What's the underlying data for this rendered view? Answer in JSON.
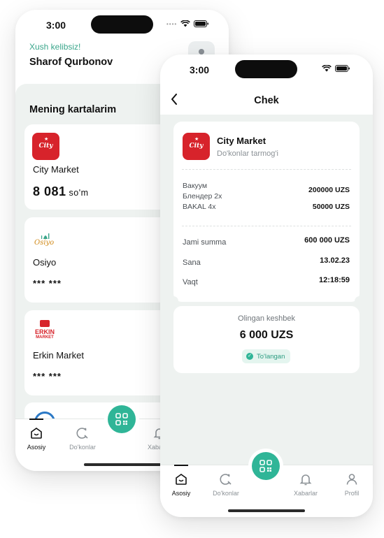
{
  "colors": {
    "accent": "#2fb597",
    "brand_red": "#d7232b",
    "background": "#eef2f0"
  },
  "back_screen": {
    "status_time": "3:00",
    "greeting": "Xush kelibsiz!",
    "user_name": "Sharof Qurbonov",
    "section_title": "Mening kartalarim",
    "cards": [
      {
        "name": "City Market",
        "logo_icon": "city-market-logo",
        "logo_text": "City",
        "balance": "8 081",
        "currency": "so'm"
      },
      {
        "name": "Osiyo",
        "logo_icon": "osiyo-logo",
        "logo_text": "Osiyo",
        "masked": "*** ***"
      },
      {
        "name": "Erkin Market",
        "logo_icon": "erkin-market-logo",
        "logo_text_1": "ERKIN",
        "logo_text_2": "MARKET",
        "masked": "*** ***"
      }
    ],
    "tabs": [
      {
        "label": "Asosiy",
        "icon": "home-icon",
        "active": true
      },
      {
        "label": "Do'konlar",
        "icon": "store-search-icon"
      },
      {
        "label": "Xabarlar",
        "icon": "bell-icon"
      }
    ]
  },
  "front_screen": {
    "status_time": "3:00",
    "title": "Chek",
    "shop_name": "City Market",
    "shop_subtitle": "Do'konlar tarmog'i",
    "logo_text": "City",
    "items": [
      {
        "name": "Вакуум",
        "price": "200000 UZS"
      },
      {
        "name": "Блендер 2x",
        "price": ""
      },
      {
        "name": "BAKAL 4x",
        "price": "50000 UZS"
      }
    ],
    "total_label": "Jami summa",
    "total_value": "600 000 UZS",
    "date_label": "Sana",
    "date_value": "13.02.23",
    "time_label": "Vaqt",
    "time_value": "12:18:59",
    "cashback_label": "Olingan keshbek",
    "cashback_amount": "6 000 UZS",
    "cashback_status": "To'langan",
    "tabs": [
      {
        "label": "Asosiy",
        "icon": "home-icon",
        "active": true
      },
      {
        "label": "Do'konlar",
        "icon": "store-search-icon"
      },
      {
        "label": "Xabarlar",
        "icon": "bell-icon"
      },
      {
        "label": "Profil",
        "icon": "user-icon"
      }
    ]
  }
}
